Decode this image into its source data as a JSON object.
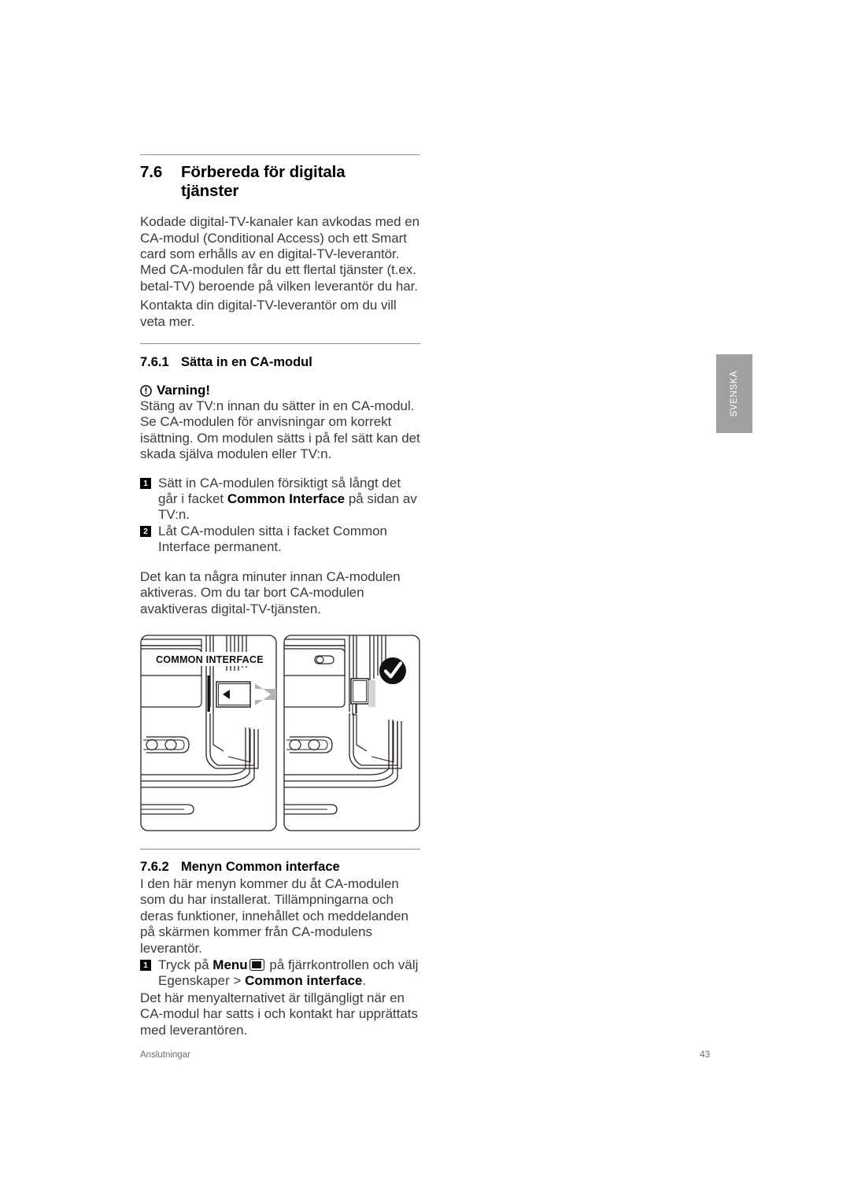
{
  "section": {
    "number": "7.6",
    "title_line1": "Förbereda för digitala",
    "title_line2": "tjänster",
    "intro": "Kodade digital-TV-kanaler kan avkodas med en CA-modul (Conditional Access) och ett Smart card som erhålls av en digital-TV-leverantör. Med CA-modulen får du ett flertal tjänster (t.ex. betal-TV) beroende på vilken leverantör du har.",
    "intro2": "Kontakta din digital-TV-leverantör om du vill veta mer."
  },
  "subsection_1": {
    "number": "7.6.1",
    "title": "Sätta in en CA-modul",
    "warning_label": "Varning!",
    "warning_icon": "warning-circle-icon",
    "warning_body": "Stäng av TV:n innan du sätter in en CA-modul. Se CA-modulen för anvisningar om korrekt isättning. Om modulen sätts i på fel sätt kan det skada själva modulen eller TV:n.",
    "steps": [
      {
        "number": "1",
        "text_before": "Sätt in CA-modulen försiktigt så långt det går i facket ",
        "bold": "Common Interface",
        "text_after": " på sidan av TV:n."
      },
      {
        "number": "2",
        "text_before": "Låt CA-modulen sitta i facket Common Interface permanent.",
        "bold": "",
        "text_after": ""
      }
    ],
    "after_steps": "Det kan ta några minuter innan CA-modulen aktiveras. Om du tar bort CA-modulen avaktiveras digital-TV-tjänsten."
  },
  "illustration": {
    "left": {
      "label": "COMMON INTERFACE",
      "arrow_icon": "insert-arrow-icon",
      "alt": "ca-module-insert-diagram"
    },
    "right": {
      "check_icon": "check-circle-icon",
      "alt": "ca-module-seated-diagram"
    }
  },
  "subsection_2": {
    "number": "7.6.2",
    "title": "Menyn Common interface",
    "body": "I den här menyn kommer du åt CA-modulen som du har installerat. Tillämpningarna och deras funktioner, innehållet och meddelanden på skärmen kommer från CA-modulens leverantör.",
    "step": {
      "number": "1",
      "part1": "Tryck på ",
      "bold1": "Menu",
      "menu_icon": "menu-button-icon",
      "part2": " på fjärrkontrollen och välj Egenskaper > ",
      "bold2": "Common interface",
      "part3": "."
    },
    "after_step": "Det här menyalternativet är tillgängligt när en CA-modul har satts i och kontakt har upprättats med leverantören."
  },
  "side_tab": {
    "label": "SVENSKA",
    "color": "#a0a0a0"
  },
  "footer": {
    "left": "Anslutningar",
    "right": "43"
  }
}
